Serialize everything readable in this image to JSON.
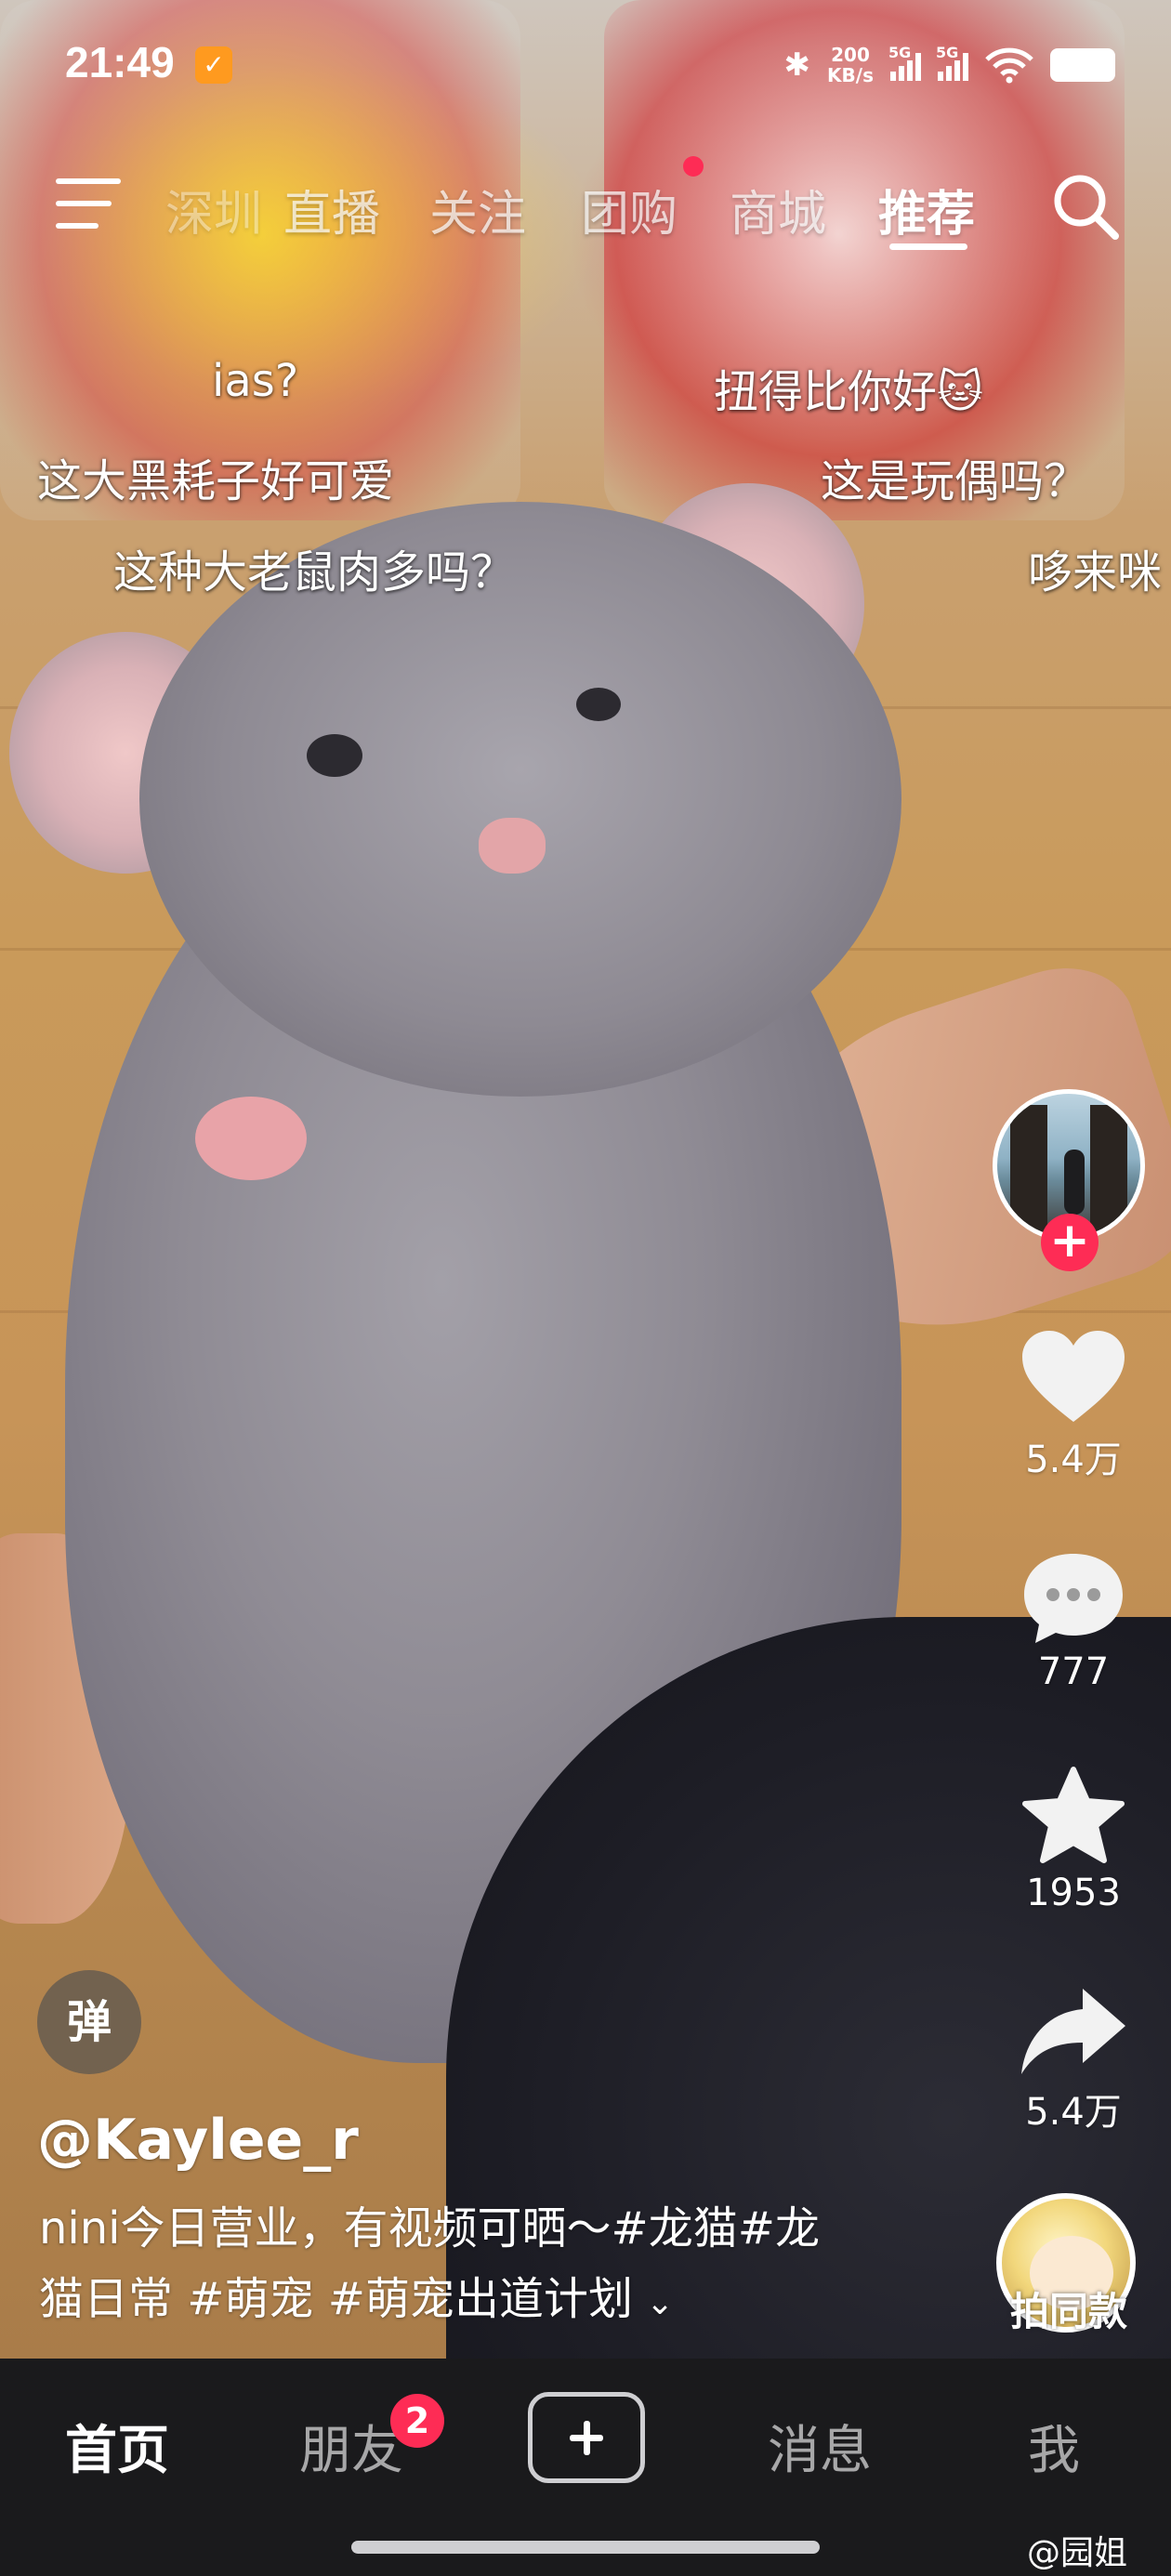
{
  "status_bar": {
    "time": "21:49",
    "network_speed_value": "200",
    "network_speed_unit": "KB/s",
    "sim1_label": "5G",
    "sim2_label": "5G"
  },
  "top_tabs": [
    {
      "label": "深圳"
    },
    {
      "label": "直播"
    },
    {
      "label": "关注"
    },
    {
      "label": "团购"
    },
    {
      "label": "商城"
    },
    {
      "label": "推荐"
    }
  ],
  "active_tab": "推荐",
  "danmu": [
    {
      "text": "ias?"
    },
    {
      "text": "扭得比你好🐱"
    },
    {
      "text": "这大黑耗子好可爱"
    },
    {
      "text": "这是玩偶吗？"
    },
    {
      "text": "这种大老鼠肉多吗？"
    },
    {
      "text": "哆来咪"
    }
  ],
  "actions": {
    "likes": "5.4万",
    "comments": "777",
    "favorites": "1953",
    "shares": "5.4万"
  },
  "danmu_toggle_label": "弹",
  "video": {
    "author": "@Kaylee_r",
    "caption_line1": "nini今日营业，有视频可晒～#龙猫#龙",
    "caption_line2": "猫日常 #萌宠 #萌宠出道计划",
    "expand_glyph": "⌄"
  },
  "music_label": "拍同款",
  "bottom_nav": {
    "home": "首页",
    "friends": "朋友",
    "friends_badge": "2",
    "messages": "消息",
    "me": "我"
  },
  "watermark": "@园姐",
  "colors": {
    "accent_red": "#fe2c55",
    "nav_bg": "#1a1a1c"
  }
}
